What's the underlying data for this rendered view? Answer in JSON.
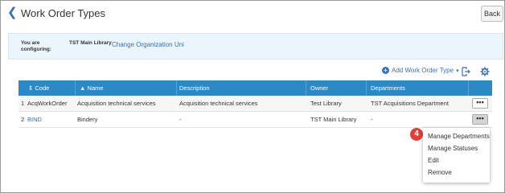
{
  "header": {
    "title": "Work Order Types",
    "back_label": "Back"
  },
  "config": {
    "label": "You are configuring:",
    "library": "TST Main Library",
    "change_link": "Change Organization Uni"
  },
  "toolbar": {
    "add_label": "Add Work Order Type",
    "icons": [
      "plus-icon",
      "caret-down-icon",
      "export-icon",
      "gear-icon"
    ]
  },
  "table": {
    "columns": [
      "Code",
      "Name",
      "Description",
      "Owner",
      "Departments"
    ],
    "rows": [
      {
        "num": "1",
        "code": "AcqWorkOrder",
        "name": "Acquisition technical services",
        "description": "Acquisition technical services",
        "owner": "Test Library",
        "departments": "TST Acquisitions Department",
        "actions": "•••"
      },
      {
        "num": "2",
        "code": "BIND",
        "name": "Bindery",
        "description": "-",
        "owner": "TST Main Library",
        "departments": "-",
        "actions": "•••"
      }
    ]
  },
  "menu": {
    "step": "4",
    "items": [
      "Manage Departments",
      "Manage Statuses",
      "Edit",
      "Remove"
    ]
  },
  "colors": {
    "accent": "#3a6fb0",
    "header_bg": "#2d89c6",
    "config_bg": "#eaf6fc",
    "badge": "#e0403a"
  }
}
